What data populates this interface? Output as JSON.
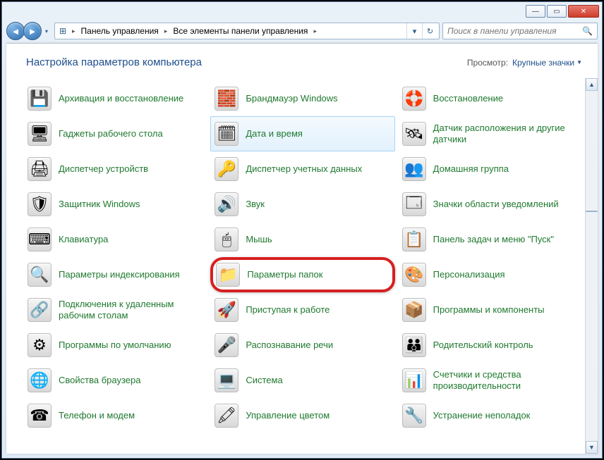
{
  "titlebar": {
    "min": "—",
    "max": "▭",
    "close": "✕"
  },
  "nav": {
    "back": "◄",
    "fwd": "►",
    "breadcrumbs": [
      "Панель управления",
      "Все элементы панели управления"
    ],
    "refresh": "↻",
    "drop": "▾"
  },
  "search": {
    "placeholder": "Поиск в панели управления"
  },
  "page": {
    "title": "Настройка параметров компьютера",
    "view_label": "Просмотр:",
    "view_value": "Крупные значки"
  },
  "items": [
    {
      "label": "Архивация и восстановление",
      "icon": "💾"
    },
    {
      "label": "Брандмауэр Windows",
      "icon": "🧱"
    },
    {
      "label": "Восстановление",
      "icon": "🛟"
    },
    {
      "label": "Гаджеты рабочего стола",
      "icon": "🖥"
    },
    {
      "label": "Дата и время",
      "icon": "🗓",
      "hover": true
    },
    {
      "label": "Датчик расположения и другие датчики",
      "icon": "🛰"
    },
    {
      "label": "Диспетчер устройств",
      "icon": "🖨"
    },
    {
      "label": "Диспетчер учетных данных",
      "icon": "🔑"
    },
    {
      "label": "Домашняя группа",
      "icon": "👥"
    },
    {
      "label": "Защитник Windows",
      "icon": "🛡"
    },
    {
      "label": "Звук",
      "icon": "🔊"
    },
    {
      "label": "Значки области уведомлений",
      "icon": "🗔"
    },
    {
      "label": "Клавиатура",
      "icon": "⌨"
    },
    {
      "label": "Мышь",
      "icon": "🖱"
    },
    {
      "label": "Панель задач и меню \"Пуск\"",
      "icon": "📋"
    },
    {
      "label": "Параметры индексирования",
      "icon": "🔍"
    },
    {
      "label": "Параметры папок",
      "icon": "📁",
      "highlight": true
    },
    {
      "label": "Персонализация",
      "icon": "🎨"
    },
    {
      "label": "Подключения к удаленным рабочим столам",
      "icon": "🔗"
    },
    {
      "label": "Приступая к работе",
      "icon": "🚀"
    },
    {
      "label": "Программы и компоненты",
      "icon": "📦"
    },
    {
      "label": "Программы по умолчанию",
      "icon": "⚙"
    },
    {
      "label": "Распознавание речи",
      "icon": "🎤"
    },
    {
      "label": "Родительский контроль",
      "icon": "👪"
    },
    {
      "label": "Свойства браузера",
      "icon": "🌐"
    },
    {
      "label": "Система",
      "icon": "💻"
    },
    {
      "label": "Счетчики и средства производительности",
      "icon": "📊"
    },
    {
      "label": "Телефон и модем",
      "icon": "☎"
    },
    {
      "label": "Управление цветом",
      "icon": "🖍"
    },
    {
      "label": "Устранение неполадок",
      "icon": "🔧"
    }
  ]
}
